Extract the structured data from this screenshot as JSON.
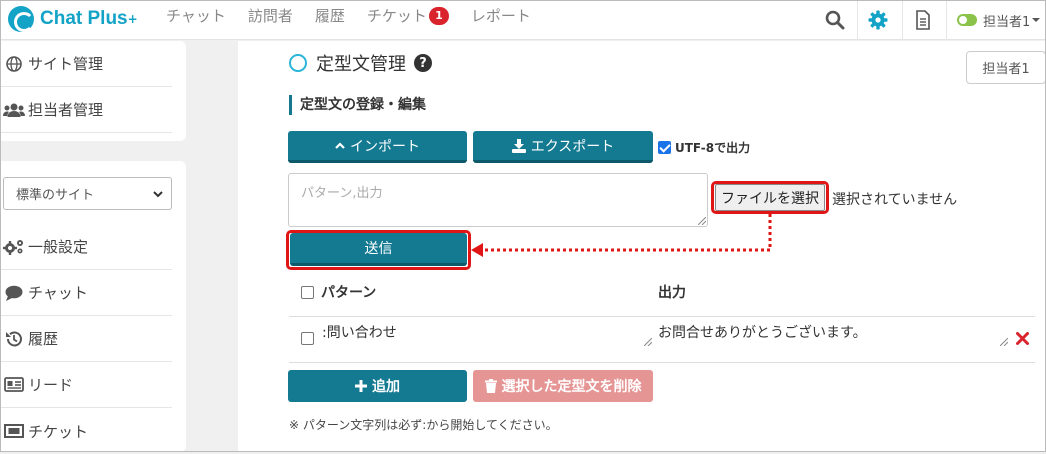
{
  "brand": {
    "name": "Chat Plus",
    "sup": "+"
  },
  "nav": {
    "chat": "チャット",
    "visitors": "訪問者",
    "history": "履歴",
    "tickets": "チケット",
    "tickets_badge": "1",
    "reports": "レポート"
  },
  "user": {
    "name": "担当者1",
    "button_label": "担当者1"
  },
  "sidebar": {
    "site_admin": "サイト管理",
    "staff_admin": "担当者管理",
    "site_select_value": "標準のサイト",
    "general_settings": "一般設定",
    "chat": "チャット",
    "history": "履歴",
    "leads": "リード",
    "tickets": "チケット"
  },
  "page": {
    "title": "定型文管理",
    "section": "定型文の登録・編集",
    "import_label": "インポート",
    "export_label": "エクスポート",
    "utf8_label": "UTF-8で出力",
    "textarea_placeholder": "パターン,出力",
    "file_button": "ファイルを選択",
    "file_status": "選択されていません",
    "submit_label": "送信"
  },
  "table": {
    "col_pattern": "パターン",
    "col_output": "出力",
    "rows": [
      {
        "pattern": ":問い合わせ",
        "output": "お問合せありがとうございます。"
      }
    ]
  },
  "actions": {
    "add_label": "追加",
    "delete_label": "選択した定型文を削除"
  },
  "note": "※ パターン文字列は必ず:から開始してください。",
  "colors": {
    "brand": "#13a3c7",
    "teal": "#137a91",
    "highlight": "#e01515",
    "delete": "#e69595"
  }
}
